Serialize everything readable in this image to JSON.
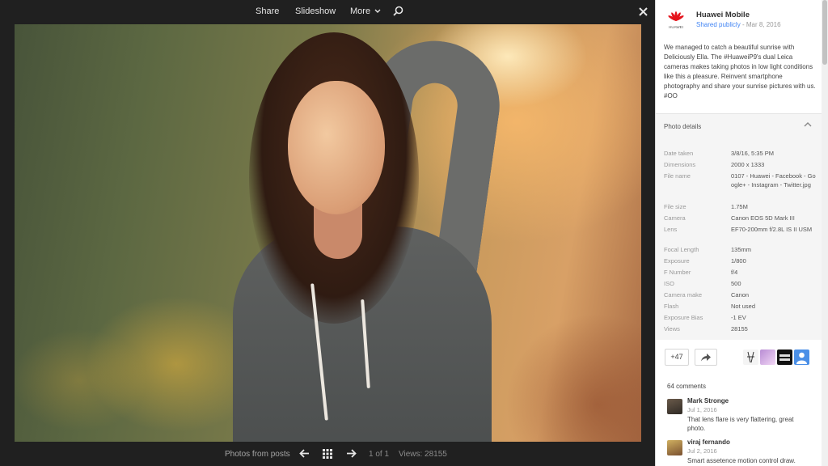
{
  "viewer": {
    "toolbar": {
      "share": "Share",
      "slideshow": "Slideshow",
      "more": "More",
      "more_icon": "chevron-down-icon",
      "search_icon": "zoom-icon",
      "close_icon": "close-icon"
    },
    "bottom": {
      "photos_from_posts": "Photos from posts",
      "counter": "1 of 1",
      "views": "Views: 28155"
    }
  },
  "post": {
    "author": "Huawei Mobile",
    "visibility": "Shared publicly",
    "date": "Mar 8, 2016",
    "logo_text": "HUAWEI",
    "text": "We managed to catch a beautiful sunrise with Deliciously Ella. The #HuaweiP9's dual Leica cameras makes taking photos in low light conditions like this a pleasure. Reinvent smartphone photography and share your sunrise pictures with us. #OO"
  },
  "details": {
    "title": "Photo details",
    "rows": [
      {
        "k": "Date taken",
        "v": "3/8/16, 5:35 PM"
      },
      {
        "k": "Dimensions",
        "v": "2000 x 1333"
      },
      {
        "k": "File name",
        "v": "0107 - Huawei - Facebook - Google+ - Instagram - Twitter.jpg"
      },
      {
        "k": "File size",
        "v": "1.75M"
      },
      {
        "k": "Camera",
        "v": "Canon EOS 5D Mark III"
      },
      {
        "k": "Lens",
        "v": "EF70-200mm f/2.8L IS II USM"
      },
      {
        "k": "Focal Length",
        "v": "135mm"
      },
      {
        "k": "Exposure",
        "v": "1/800"
      },
      {
        "k": "F Number",
        "v": "f/4"
      },
      {
        "k": "ISO",
        "v": "500"
      },
      {
        "k": "Camera make",
        "v": "Canon"
      },
      {
        "k": "Flash",
        "v": "Not used"
      },
      {
        "k": "Exposure Bias",
        "v": "-1 EV"
      },
      {
        "k": "Views",
        "v": "28155"
      }
    ]
  },
  "actions": {
    "plus": "+47",
    "share_icon": "share-arrow-icon"
  },
  "comments": {
    "count": "64 comments",
    "items": [
      {
        "name": "Mark Stronge",
        "date": "Jul 1, 2016",
        "text": "That lens flare is very flattering, great photo."
      },
      {
        "name": "viraj fernando",
        "date": "Jul 2, 2016",
        "text": "Smart assetence motion control draw."
      }
    ]
  },
  "colors": {
    "accent": "#4285f4",
    "huawei_red": "#e5151d"
  }
}
